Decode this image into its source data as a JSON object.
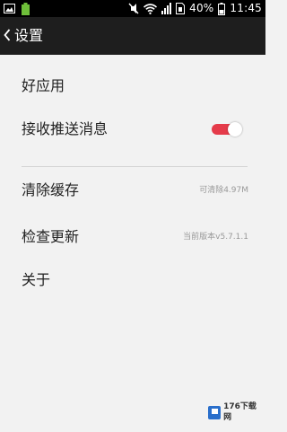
{
  "status_bar": {
    "battery_percent": "40%",
    "time": "11:45",
    "icons": [
      "image-icon",
      "battery-notify-icon",
      "mute-icon",
      "wifi-icon",
      "signal-icon",
      "sim-icon",
      "battery-icon"
    ]
  },
  "title_bar": {
    "back_icon": "chevron-left-icon",
    "title": "设置"
  },
  "settings": {
    "good_apps": {
      "label": "好应用"
    },
    "push": {
      "label": "接收推送消息",
      "toggle_on": true,
      "accent_color": "#e53b4a"
    },
    "clear_cache": {
      "label": "清除缓存",
      "value": "可清除4.97M"
    },
    "check_update": {
      "label": "检查更新",
      "value": "当前版本v5.7.1.1"
    },
    "about": {
      "label": "关于"
    }
  },
  "watermark": {
    "text": "176下载网"
  }
}
